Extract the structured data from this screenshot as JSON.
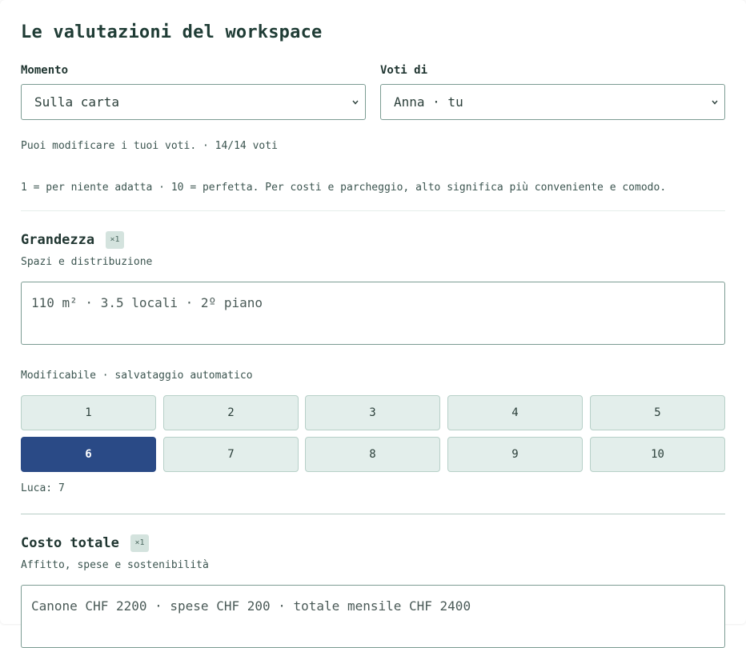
{
  "title": "Le valutazioni del workspace",
  "filters": {
    "moment_label": "Momento",
    "moment_value": "Sulla carta",
    "voter_label": "Voti di",
    "voter_value": "Anna · tu"
  },
  "status_text": "Puoi modificare i tuoi voti. · 14/14 voti",
  "scale_note": "1 = per niente adatta · 10 = perfetta. Per costi e parcheggio, alto significa più conveniente e comodo.",
  "criteria": [
    {
      "title": "Grandezza",
      "weight": "×1",
      "subtitle": "Spazi e distribuzione",
      "details": "110 m² · 3.5 locali · 2º piano",
      "edit_note": "Modificabile · salvataggio automatico",
      "scores": [
        "1",
        "2",
        "3",
        "4",
        "5",
        "6",
        "7",
        "8",
        "9",
        "10"
      ],
      "selected_score": 6,
      "other_votes": "Luca: 7"
    },
    {
      "title": "Costo totale",
      "weight": "×1",
      "subtitle": "Affitto, spese e sostenibilità",
      "details": "Canone CHF 2200 · spese CHF 200 · totale mensile CHF 2400"
    }
  ],
  "colors": {
    "accent": "#2a4a86",
    "score_bg": "#e3eeeb",
    "badge_bg": "#d4e3de",
    "border": "#7c9c93"
  },
  "icons": {
    "select_chevron": "chevron-down-icon"
  }
}
